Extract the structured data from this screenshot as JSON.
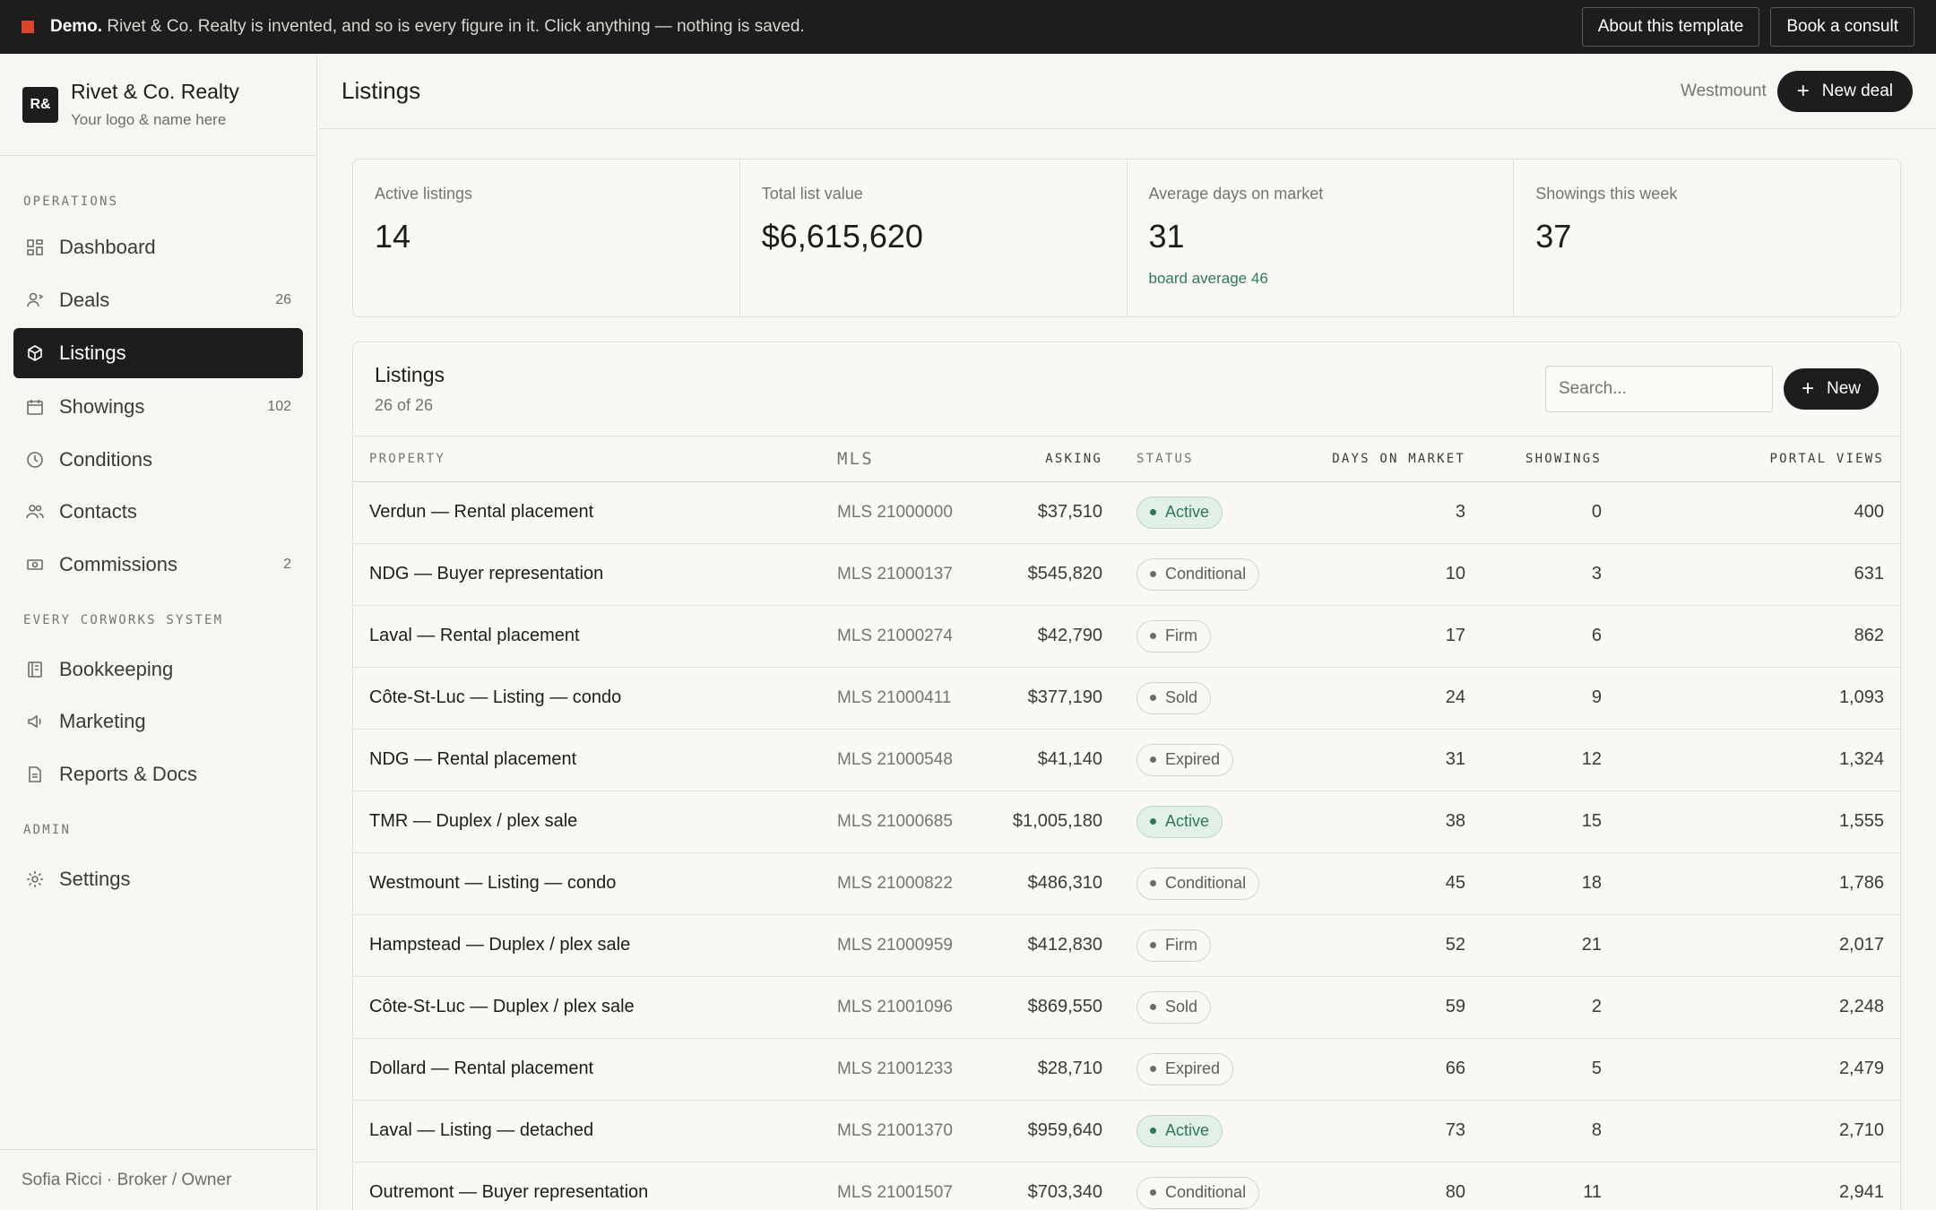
{
  "banner": {
    "strong": "Demo.",
    "message": "Rivet & Co. Realty is invented, and so is every figure in it. Click anything — nothing is saved.",
    "about_label": "About this template",
    "consult_label": "Book a consult"
  },
  "brand": {
    "logo": "R&",
    "name": "Rivet & Co. Realty",
    "tagline": "Your logo & name here"
  },
  "sidebar": {
    "sections": [
      {
        "label": "OPERATIONS"
      },
      {
        "label": "EVERY CORWORKS SYSTEM"
      },
      {
        "label": "ADMIN"
      }
    ],
    "items": [
      {
        "label": "Dashboard",
        "icon": "dashboard-icon",
        "count": ""
      },
      {
        "label": "Deals",
        "icon": "deals-icon",
        "count": "26"
      },
      {
        "label": "Listings",
        "icon": "cube-icon",
        "count": "",
        "active": true
      },
      {
        "label": "Showings",
        "icon": "calendar-icon",
        "count": "102"
      },
      {
        "label": "Conditions",
        "icon": "clock-icon",
        "count": ""
      },
      {
        "label": "Contacts",
        "icon": "contacts-icon",
        "count": ""
      },
      {
        "label": "Commissions",
        "icon": "cash-icon",
        "count": "2"
      },
      {
        "label": "Bookkeeping",
        "icon": "ledger-icon",
        "count": ""
      },
      {
        "label": "Marketing",
        "icon": "megaphone-icon",
        "count": ""
      },
      {
        "label": "Reports & Docs",
        "icon": "document-icon",
        "count": ""
      },
      {
        "label": "Settings",
        "icon": "gear-icon",
        "count": ""
      }
    ],
    "footer": "Sofia Ricci · Broker / Owner"
  },
  "header": {
    "title": "Listings",
    "location": "Westmount",
    "new_deal_label": "New deal"
  },
  "stats": [
    {
      "label": "Active listings",
      "value": "14",
      "note": ""
    },
    {
      "label": "Total list value",
      "value": "$6,615,620",
      "note": ""
    },
    {
      "label": "Average days on market",
      "value": "31",
      "note": "board average 46"
    },
    {
      "label": "Showings this week",
      "value": "37",
      "note": ""
    }
  ],
  "table": {
    "title": "Listings",
    "subtitle": "26 of 26",
    "search_placeholder": "Search...",
    "new_label": "New",
    "columns": [
      "PROPERTY",
      "MLS",
      "ASKING",
      "STATUS",
      "DAYS ON MARKET",
      "SHOWINGS",
      "PORTAL VIEWS"
    ],
    "rows": [
      {
        "property": "Verdun — Rental placement",
        "mls": "MLS 21000000",
        "asking": "$37,510",
        "status": "Active",
        "dom": "3",
        "showings": "0",
        "views": "400"
      },
      {
        "property": "NDG — Buyer representation",
        "mls": "MLS 21000137",
        "asking": "$545,820",
        "status": "Conditional",
        "dom": "10",
        "showings": "3",
        "views": "631"
      },
      {
        "property": "Laval — Rental placement",
        "mls": "MLS 21000274",
        "asking": "$42,790",
        "status": "Firm",
        "dom": "17",
        "showings": "6",
        "views": "862"
      },
      {
        "property": "Côte-St-Luc — Listing — condo",
        "mls": "MLS 21000411",
        "asking": "$377,190",
        "status": "Sold",
        "dom": "24",
        "showings": "9",
        "views": "1,093"
      },
      {
        "property": "NDG — Rental placement",
        "mls": "MLS 21000548",
        "asking": "$41,140",
        "status": "Expired",
        "dom": "31",
        "showings": "12",
        "views": "1,324"
      },
      {
        "property": "TMR — Duplex / plex sale",
        "mls": "MLS 21000685",
        "asking": "$1,005,180",
        "status": "Active",
        "dom": "38",
        "showings": "15",
        "views": "1,555"
      },
      {
        "property": "Westmount — Listing — condo",
        "mls": "MLS 21000822",
        "asking": "$486,310",
        "status": "Conditional",
        "dom": "45",
        "showings": "18",
        "views": "1,786"
      },
      {
        "property": "Hampstead — Duplex / plex sale",
        "mls": "MLS 21000959",
        "asking": "$412,830",
        "status": "Firm",
        "dom": "52",
        "showings": "21",
        "views": "2,017"
      },
      {
        "property": "Côte-St-Luc — Duplex / plex sale",
        "mls": "MLS 21001096",
        "asking": "$869,550",
        "status": "Sold",
        "dom": "59",
        "showings": "2",
        "views": "2,248"
      },
      {
        "property": "Dollard — Rental placement",
        "mls": "MLS 21001233",
        "asking": "$28,710",
        "status": "Expired",
        "dom": "66",
        "showings": "5",
        "views": "2,479"
      },
      {
        "property": "Laval — Listing — detached",
        "mls": "MLS 21001370",
        "asking": "$959,640",
        "status": "Active",
        "dom": "73",
        "showings": "8",
        "views": "2,710"
      },
      {
        "property": "Outremont — Buyer representation",
        "mls": "MLS 21001507",
        "asking": "$703,340",
        "status": "Conditional",
        "dom": "80",
        "showings": "11",
        "views": "2,941"
      }
    ]
  },
  "colors": {
    "accent_dark": "#1d1d1d",
    "status_active_green": "#2e7a57",
    "banner_square": "#d9462b"
  }
}
